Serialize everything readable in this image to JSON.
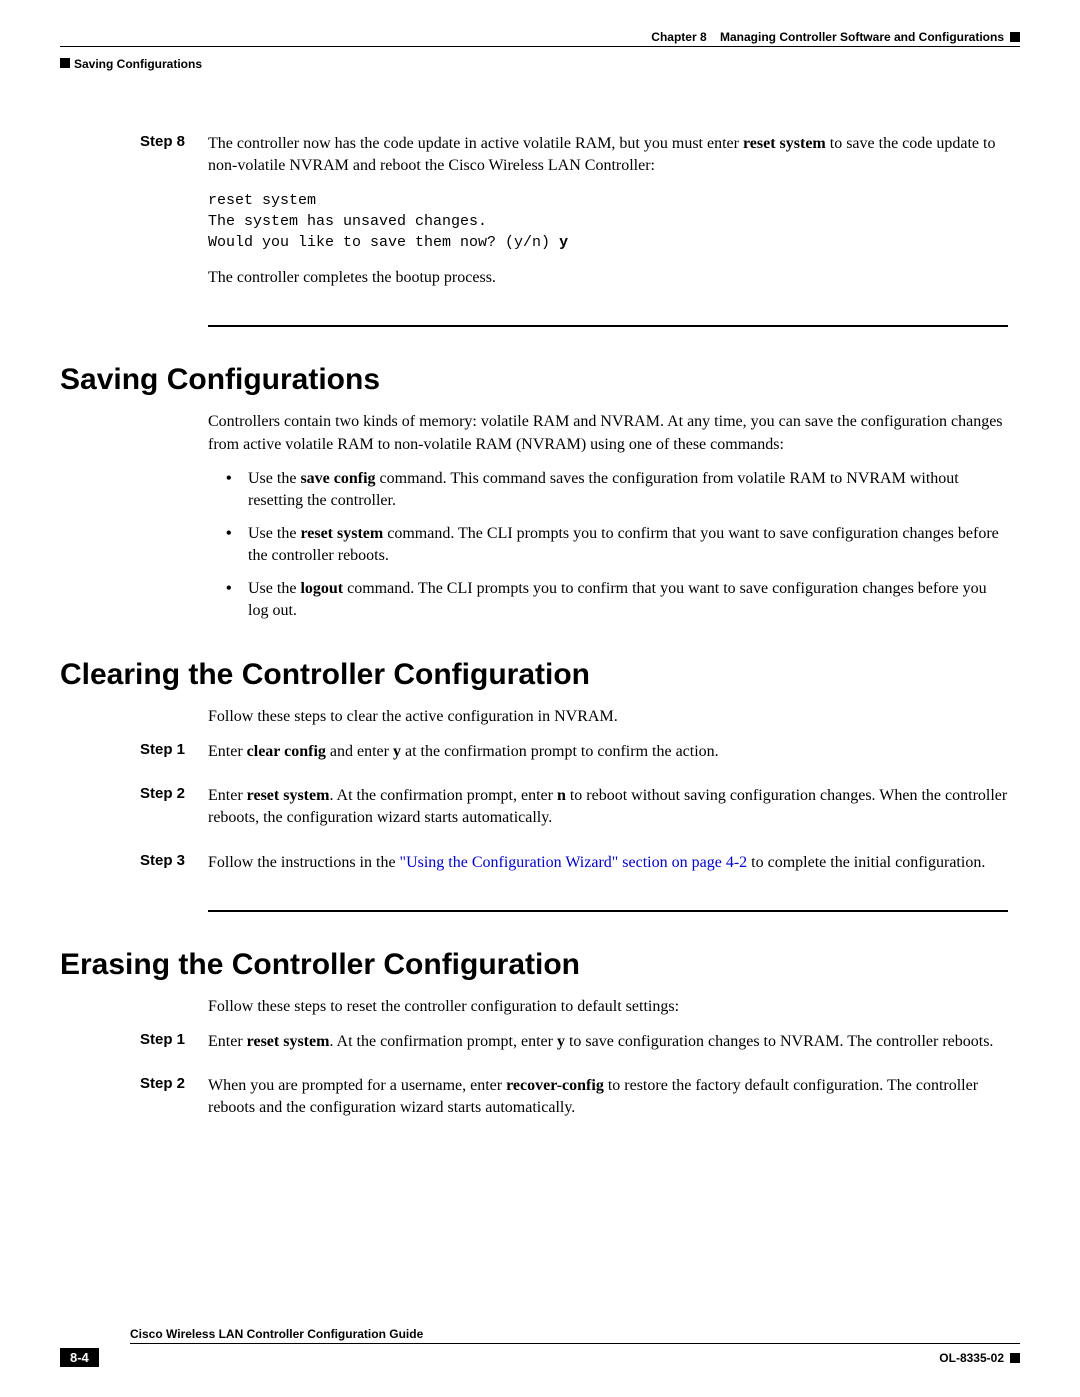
{
  "header": {
    "section_marker": "Saving Configurations",
    "chapter_label": "Chapter 8",
    "chapter_title": "Managing Controller Software and Configurations"
  },
  "step8": {
    "label": "Step 8",
    "para1_a": "The controller now has the code update in active volatile RAM, but you must enter ",
    "para1_cmd": "reset system",
    "para1_b": " to save the code update to non-volatile NVRAM and reboot the Cisco Wireless LAN Controller:",
    "code_line1": "reset system",
    "code_line2": "The system has unsaved changes.",
    "code_line3": "Would you like to save them now? (y/n) ",
    "code_y": "y",
    "para2": "The controller completes the bootup process."
  },
  "saving": {
    "heading": "Saving Configurations",
    "intro": "Controllers contain two kinds of memory: volatile RAM and NVRAM. At any time, you can save the configuration changes from active volatile RAM to non-volatile RAM (NVRAM) using one of these commands:",
    "b1_a": "Use the ",
    "b1_cmd": "save config",
    "b1_b": " command. This command saves the configuration from volatile RAM to NVRAM without resetting the controller.",
    "b2_a": "Use the ",
    "b2_cmd": "reset system",
    "b2_b": " command. The CLI prompts you to confirm that you want to save configuration changes before the controller reboots.",
    "b3_a": "Use the ",
    "b3_cmd": "logout",
    "b3_b": " command. The CLI prompts you to confirm that you want to save configuration changes before you log out."
  },
  "clearing": {
    "heading": "Clearing the Controller Configuration",
    "intro": "Follow these steps to clear the active configuration in NVRAM.",
    "step1": {
      "label": "Step 1",
      "a": "Enter ",
      "cmd1": "clear config",
      "b": " and enter ",
      "cmd2": "y",
      "c": " at the confirmation prompt to confirm the action."
    },
    "step2": {
      "label": "Step 2",
      "a": "Enter ",
      "cmd1": "reset system",
      "b": ". At the confirmation prompt, enter ",
      "cmd2": "n",
      "c": " to reboot without saving configuration changes. When the controller reboots, the configuration wizard starts automatically."
    },
    "step3": {
      "label": "Step 3",
      "a": "Follow the instructions in the ",
      "link": "\"Using the Configuration Wizard\" section on page 4-2",
      "b": " to complete the initial configuration."
    }
  },
  "erasing": {
    "heading": "Erasing the Controller Configuration",
    "intro": "Follow these steps to reset the controller configuration to default settings:",
    "step1": {
      "label": "Step 1",
      "a": "Enter ",
      "cmd1": "reset system",
      "b": ". At the confirmation prompt, enter ",
      "cmd2": "y",
      "c": " to save configuration changes to NVRAM. The controller reboots."
    },
    "step2": {
      "label": "Step 2",
      "a": "When you are prompted for a username, enter ",
      "cmd1": "recover-config",
      "b": " to restore the factory default configuration. The controller reboots and the configuration wizard starts automatically."
    }
  },
  "footer": {
    "book_title": "Cisco Wireless LAN Controller Configuration Guide",
    "page_num": "8-4",
    "doc_id": "OL-8335-02"
  }
}
